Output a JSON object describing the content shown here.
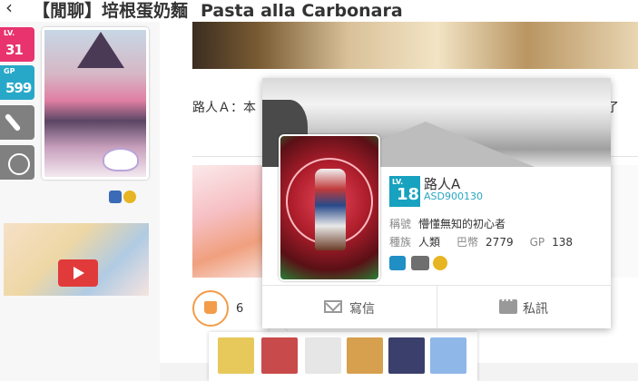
{
  "header": {
    "title_zh": "【閒聊】培根蛋奶麵",
    "title_en": "Pasta alla Carbonara"
  },
  "sidebar": {
    "level_label": "LV.",
    "level_value": "31",
    "gp_label": "GP",
    "gp_value": "599"
  },
  "post": {
    "text": "路人Ａ：本",
    "text_tail": "了",
    "like_count": "6"
  },
  "popup": {
    "level_label": "LV.",
    "level_value": "18",
    "name": "路人A",
    "user_id": "ASD900130",
    "title_label": "稱號",
    "title_value": "懵懂無知的初心者",
    "race_label": "種族",
    "race_value": "人類",
    "coin_label": "巴幣",
    "coin_value": "2779",
    "gp_label": "GP",
    "gp_value": "138",
    "mail_label": "寫信",
    "pm_label": "私訊"
  },
  "likers": [
    {
      "icon": "blonde-spiky-avatar",
      "color": "#e7c95b"
    },
    {
      "icon": "white-hat-avatar",
      "color": "#c94a4a"
    },
    {
      "icon": "white-cat-avatar",
      "color": "#e6e6e6"
    },
    {
      "icon": "lion-avatar",
      "color": "#d7a04e"
    },
    {
      "icon": "dark-hair-avatar",
      "color": "#3b3f6b"
    },
    {
      "icon": "blue-hair-maid-avatar",
      "color": "#8fb7e8"
    }
  ],
  "colors": {
    "accent_orange": "#f39c4a",
    "level_pink": "#e8336f",
    "gp_teal": "#28a8c8",
    "id_blue": "#2aa7c3"
  }
}
